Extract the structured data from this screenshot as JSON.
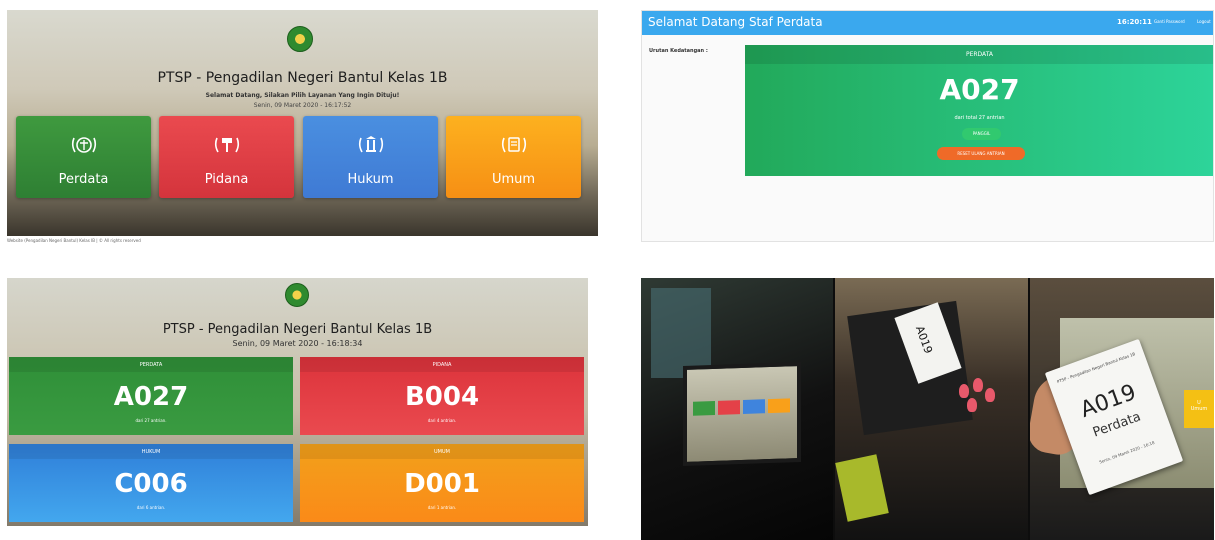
{
  "kiosk": {
    "title": "PTSP - Pengadilan Negeri Bantul Kelas 1B",
    "subtitle": "Selamat Datang, Silakan Pilih Layanan Yang Ingin Dituju!",
    "datetime": "Senin, 09 Maret 2020 - 16:17:52",
    "services": [
      {
        "label": "Perdata",
        "icon": "scales-icon"
      },
      {
        "label": "Pidana",
        "icon": "gavel-icon"
      },
      {
        "label": "Hukum",
        "icon": "pillar-icon"
      },
      {
        "label": "Umum",
        "icon": "book-icon"
      }
    ],
    "footer": "Website (Pengadilan Negeri Bantul) Kelas IB | © All rights reserved"
  },
  "staff": {
    "header_title": "Selamat Datang Staf Perdata",
    "clock": "16:20:11",
    "change_password": "Ganti Password",
    "logout": "Logout",
    "queue_label": "Urutan Kedatangan :",
    "panel_header": "PERDATA",
    "current_number": "A027",
    "count_text": "dari total 27 antrian",
    "call_button": "PANGGIL",
    "reset_button": "RESET ULANG ANTRIAN"
  },
  "display": {
    "title": "PTSP - Pengadilan Negeri Bantul Kelas 1B",
    "datetime": "Senin, 09 Maret 2020 - 16:18:34",
    "queues": [
      {
        "label": "PERDATA",
        "number": "A027",
        "count": "dari 27 antrian."
      },
      {
        "label": "PIDANA",
        "number": "B004",
        "count": "dari 4 antrian."
      },
      {
        "label": "HUKUM",
        "number": "C006",
        "count": "dari 6 antrian."
      },
      {
        "label": "UMUM",
        "number": "D001",
        "count": "dari 1 antrian."
      }
    ]
  },
  "photos": {
    "ticket_header": "PTSP - Pengadilan Negeri Bantul Kelas 1B",
    "ticket_number": "A019",
    "ticket_category": "Perdata",
    "ticket_footer": "Senin, 09 Maret 2020 - 16:18",
    "tile_label": "Umum",
    "tile_number": "U"
  },
  "colors": {
    "green": "#3a9b41",
    "red": "#e44148",
    "blue": "#3f84dd",
    "orange": "#f9a01a",
    "teal_green": "#2dd49a",
    "staff_bar": "#3aa8ee"
  }
}
